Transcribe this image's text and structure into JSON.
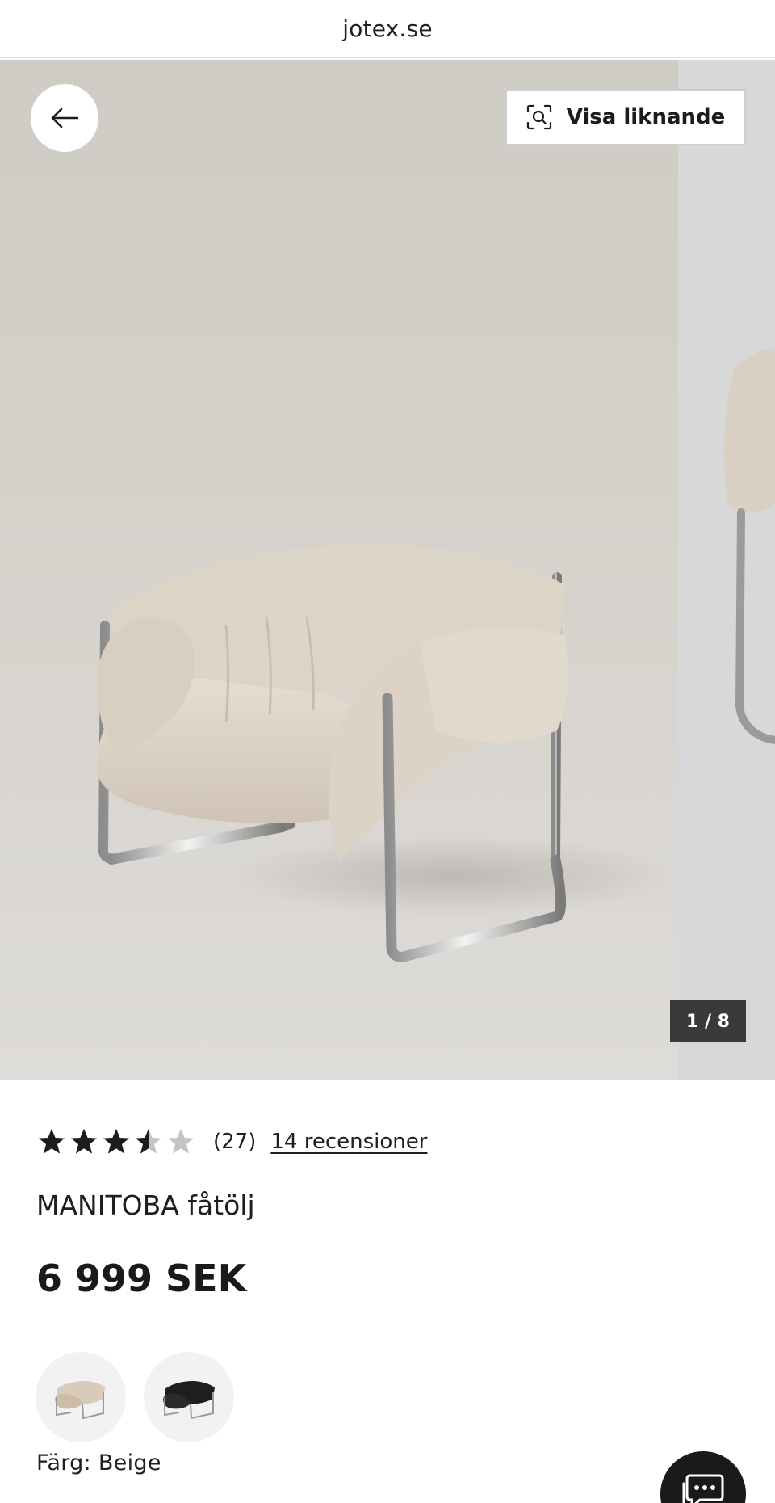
{
  "browser": {
    "url": "jotex.se"
  },
  "gallery": {
    "image_alt": "MANITOBA fåtölj",
    "back_icon": "arrow-left-icon",
    "similar": {
      "label": "Visa liknande",
      "icon": "visual-search-icon"
    },
    "counter": "1 / 8"
  },
  "product": {
    "rating_value": 3.5,
    "rating_max": 5,
    "rating_count": "(27)",
    "reviews_link": "14 recensioner",
    "title": "MANITOBA fåtölj",
    "price": "6 999 SEK",
    "color_label": "Färg: Beige",
    "swatches": [
      {
        "name": "Beige",
        "selected": true
      },
      {
        "name": "Svart",
        "selected": false
      }
    ]
  },
  "chat": {
    "icon": "chat-bubble-icon"
  },
  "colors": {
    "text": "#1c1c1c",
    "star_filled": "#1c1c1c",
    "star_empty": "#c4c4c4",
    "counter_bg": "#3a3a3a",
    "chat_bg": "#1a1a1a"
  }
}
